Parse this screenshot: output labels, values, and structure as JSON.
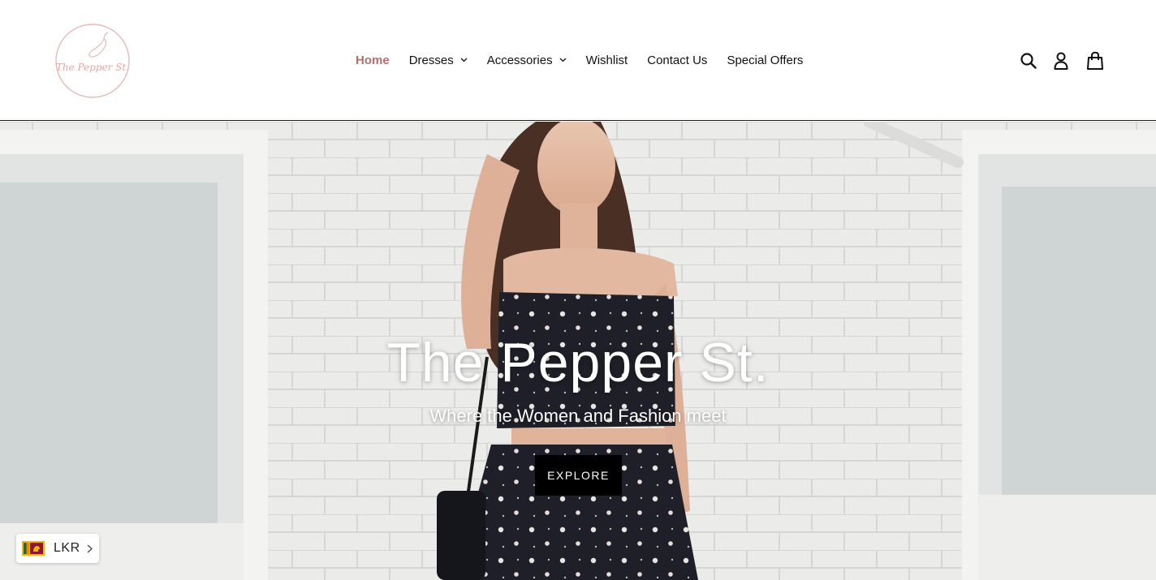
{
  "logo": {
    "text": "The Pepper St."
  },
  "nav": {
    "items": [
      {
        "label": "Home",
        "active": true,
        "dropdown": false
      },
      {
        "label": "Dresses",
        "active": false,
        "dropdown": true
      },
      {
        "label": "Accessories",
        "active": false,
        "dropdown": true
      },
      {
        "label": "Wishlist",
        "active": false,
        "dropdown": false
      },
      {
        "label": "Contact Us",
        "active": false,
        "dropdown": false
      },
      {
        "label": "Special Offers",
        "active": false,
        "dropdown": false
      }
    ]
  },
  "header_icons": [
    "search-icon",
    "account-icon",
    "cart-icon"
  ],
  "hero": {
    "title": "The Pepper St.",
    "subtitle": "Where the Women and Fashion meet",
    "button_label": "EXPLORE"
  },
  "currency": {
    "code": "LKR",
    "flag": "sri-lanka-flag-icon"
  },
  "colors": {
    "accent": "#b46e6c",
    "button_bg": "#000000",
    "logo_pink": "#e7b9b9"
  }
}
